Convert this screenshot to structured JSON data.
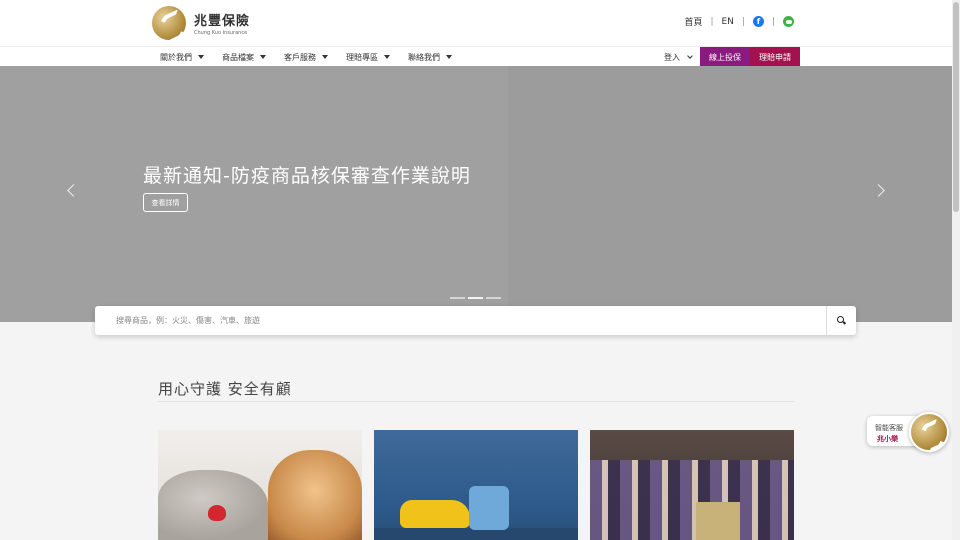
{
  "header": {
    "logo_cn": "兆豐保險",
    "logo_en": "Chung Kuo Insurance",
    "links": {
      "home": "首頁",
      "lang": "EN"
    },
    "icons": {
      "facebook": "facebook-icon",
      "line": "line-icon"
    }
  },
  "nav": {
    "items": [
      {
        "label": "關於我們"
      },
      {
        "label": "商品檔案"
      },
      {
        "label": "客戶服務"
      },
      {
        "label": "理賠專區"
      },
      {
        "label": "聯絡我們"
      }
    ],
    "login": "登入",
    "online_insure": "線上投保",
    "claim_apply": "理賠申請",
    "colors": {
      "online": "#8a1a7e",
      "claim": "#a3124e"
    }
  },
  "hero": {
    "title": "最新通知-防疫商品核保審查作業說明",
    "button": "查看詳情",
    "slides": 3,
    "active_slide": 2
  },
  "search": {
    "placeholder": "搜尋商品，例：火災、傷害、汽車、旅遊"
  },
  "section": {
    "title": "用心守護 安全有顧"
  },
  "chat": {
    "label1": "智能客服",
    "label2": "兆小樂"
  }
}
